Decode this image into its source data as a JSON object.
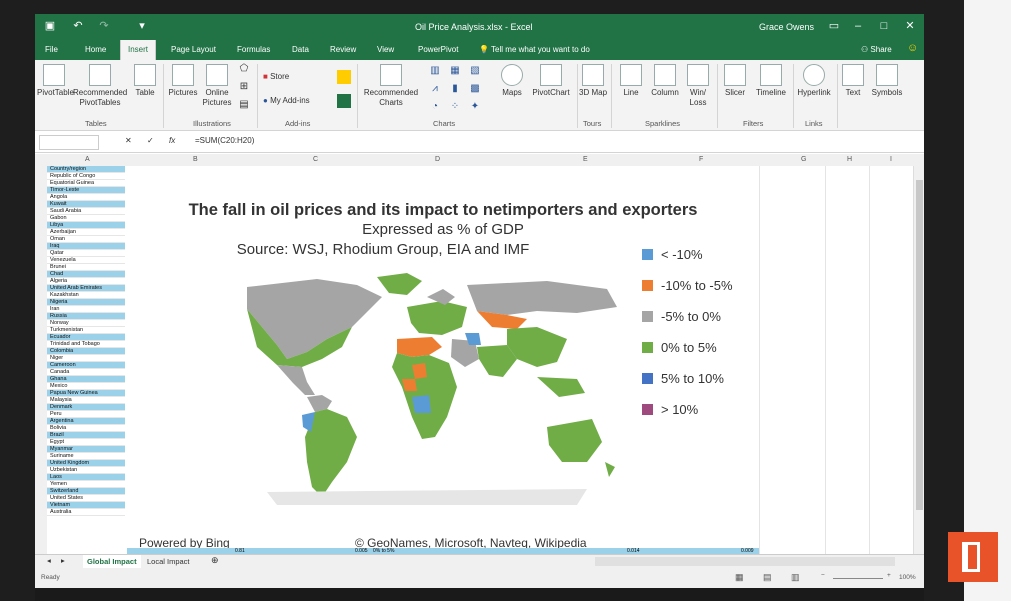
{
  "window": {
    "title": "Oil Price Analysis.xlsx - Excel",
    "user": "Grace Owens",
    "share_label": "Share"
  },
  "tabs": [
    "File",
    "Home",
    "Insert",
    "Page Layout",
    "Formulas",
    "Data",
    "Review",
    "View",
    "PowerPivot"
  ],
  "active_tab": "Insert",
  "tell_me": "Tell me what you want to do",
  "ribbon": {
    "buttons": {
      "pivottable": "PivotTable",
      "recommended_pivottables": "Recommended PivotTables",
      "table": "Table",
      "pictures": "Pictures",
      "online_pictures": "Online Pictures",
      "store": "Store",
      "my_addins": "My Add-ins",
      "recommended_charts": "Recommended Charts",
      "maps": "Maps",
      "pivotchart": "PivotChart",
      "map_3d": "3D Map",
      "line": "Line",
      "column": "Column",
      "win_loss": "Win/ Loss",
      "slicer": "Slicer",
      "timeline": "Timeline",
      "hyperlink": "Hyperlink",
      "text": "Text",
      "symbols": "Symbols"
    },
    "groups": {
      "tables": "Tables",
      "illustrations": "Illustrations",
      "addins": "Add-ins",
      "charts": "Charts",
      "tours": "Tours",
      "sparklines": "Sparklines",
      "filters": "Filters",
      "links": "Links"
    }
  },
  "formula_bar": {
    "name_box": "",
    "fx": "fx",
    "formula": "=SUM(C20:H20)"
  },
  "columns": [
    "A",
    "B",
    "C",
    "D",
    "E",
    "F",
    "G",
    "H",
    "I"
  ],
  "rows": [
    "Country/region",
    "Republic of Congo",
    "Equatorial Guinea",
    "Timor-Leste",
    "Angola",
    "Kuwait",
    "Saudi Arabia",
    "Gabon",
    "Libya",
    "Azerbaijan",
    "Oman",
    "Iraq",
    "Qatar",
    "Venezuela",
    "Brunei",
    "Chad",
    "Algeria",
    "United Arab Emirates",
    "Kazakhstan",
    "Nigeria",
    "Iran",
    "Russia",
    "Norway",
    "Turkmenistan",
    "Ecuador",
    "Trinidad and Tobago",
    "Colombia",
    "Niger",
    "Cameroon",
    "Canada",
    "Ghana",
    "Mexico",
    "Papua New Guinea",
    "Malaysia",
    "Denmark",
    "Peru",
    "Argentina",
    "Bolivia",
    "Brazil",
    "Egypt",
    "Myanmar",
    "Suriname",
    "United Kingdom",
    "Uzbekistan",
    "Laos",
    "Yemen",
    "Switzerland",
    "United States",
    "Vietnam",
    "Australia"
  ],
  "bottom_row_values": [
    "0.81",
    "0.005",
    "0% to 5%",
    "0.014",
    "0.009"
  ],
  "map": {
    "title": "The fall in oil prices and its impact to netimporters and exporters",
    "subtitle": "Expressed as % of GDP",
    "source": "Source: WSJ, Rhodium Group, EIA and IMF",
    "powered_by": "Powered by Bing",
    "copyright": "© GeoNames, Microsoft, Navteq, Wikipedia",
    "legend": [
      {
        "label": "< -10%",
        "color": "#5b9bd5"
      },
      {
        "label": "-10% to -5%",
        "color": "#ed7d31"
      },
      {
        "label": "-5% to 0%",
        "color": "#a5a5a5"
      },
      {
        "label": "0% to 5%",
        "color": "#70ad47"
      },
      {
        "label": "5% to 10%",
        "color": "#4472c4"
      },
      {
        "label": "> 10%",
        "color": "#9e4a7f"
      }
    ]
  },
  "sheets": [
    "Global Impact",
    "Local Impact"
  ],
  "status": {
    "ready": "Ready",
    "zoom": "100%"
  }
}
